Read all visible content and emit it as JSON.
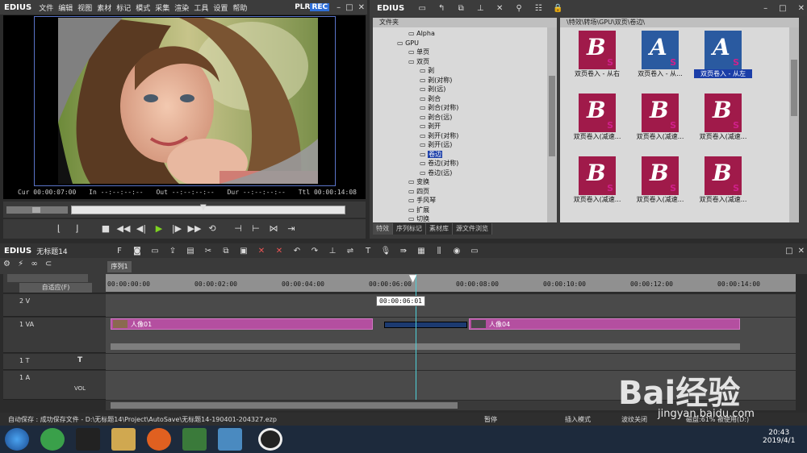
{
  "app": {
    "logo": "EDIUS",
    "menu": [
      "文件",
      "编辑",
      "视图",
      "素材",
      "标记",
      "模式",
      "采集",
      "渲染",
      "工具",
      "设置",
      "帮助"
    ],
    "plr": "PLR",
    "rec": "REC"
  },
  "viewer": {
    "cur_label": "Cur",
    "cur": "00:00:07:00",
    "in_label": "In",
    "in": "--:--:--:--",
    "out_label": "Out",
    "out": "--:--:--:--",
    "dur_label": "Dur",
    "dur": "--:--:--:--",
    "ttl_label": "Ttl",
    "ttl": "00:00:14:08"
  },
  "library": {
    "logo": "EDIUS",
    "folder_header": "文件夹",
    "path": "\\特效\\转场\\GPU\\双页\\卷边\\",
    "tree": [
      {
        "label": "Alpha",
        "level": 2
      },
      {
        "label": "GPU",
        "level": 1
      },
      {
        "label": "单页",
        "level": 2
      },
      {
        "label": "双页",
        "level": 2
      },
      {
        "label": "剥",
        "level": 3
      },
      {
        "label": "剥(对称)",
        "level": 3
      },
      {
        "label": "剥(远)",
        "level": 3
      },
      {
        "label": "剥合",
        "level": 3
      },
      {
        "label": "剥合(对称)",
        "level": 3
      },
      {
        "label": "剥合(远)",
        "level": 3
      },
      {
        "label": "剥开",
        "level": 3
      },
      {
        "label": "剥开(对称)",
        "level": 3
      },
      {
        "label": "剥开(远)",
        "level": 3
      },
      {
        "label": "卷边",
        "level": 3,
        "selected": true
      },
      {
        "label": "卷边(对称)",
        "level": 3
      },
      {
        "label": "卷边(远)",
        "level": 3
      },
      {
        "label": "变换",
        "level": 2
      },
      {
        "label": "四页",
        "level": 2
      },
      {
        "label": "手风琴",
        "level": 2
      },
      {
        "label": "扩展",
        "level": 2
      },
      {
        "label": "切换",
        "level": 2
      }
    ],
    "thumbs": [
      {
        "letter": "B",
        "caption": "双页卷入 - 从右",
        "selected": false
      },
      {
        "letter": "A",
        "caption": "双页卷入 - 从...",
        "selected": false
      },
      {
        "letter": "A",
        "caption": "双页卷入 - 从左",
        "selected": true
      },
      {
        "letter": "B",
        "caption": "双页卷入(减速...",
        "selected": false
      },
      {
        "letter": "B",
        "caption": "双页卷入(减速...",
        "selected": false
      },
      {
        "letter": "B",
        "caption": "双页卷入(减速...",
        "selected": false
      },
      {
        "letter": "B",
        "caption": "双页卷入(减速...",
        "selected": false
      },
      {
        "letter": "B",
        "caption": "双页卷入(减速...",
        "selected": false
      },
      {
        "letter": "B",
        "caption": "双页卷入(减速...",
        "selected": false
      }
    ],
    "tabs": [
      "特效",
      "序列标记",
      "素材库",
      "源文件浏览"
    ]
  },
  "timeline": {
    "logo": "EDIUS",
    "project": "无标题14",
    "sequence_tab": "序列1",
    "fit_label": "自适应(F)",
    "playhead_tc": "00:00:06:01",
    "ruler_labels": [
      "00:00:00:00",
      "00:00:02:00",
      "00:00:04:00",
      "00:00:06:00",
      "00:00:08:00",
      "00:00:10:00",
      "00:00:12:00",
      "00:00:14:00"
    ],
    "tracks": [
      {
        "name": "2 V"
      },
      {
        "name": "1 VA"
      },
      {
        "name": "1 T"
      },
      {
        "name": "1 A"
      }
    ],
    "clips": [
      {
        "label": "人像01"
      },
      {
        "label": "人像04"
      }
    ],
    "vol_label": "VOL"
  },
  "status": {
    "autosave": "自动保存 : 成功保存文件 - D:\\无标题14\\Project\\AutoSave\\无标题14-190401-204327.ezp",
    "pause": "暂停",
    "insert_mode": "插入模式",
    "ripple": "波纹关闭",
    "disk": "磁盘:61% 被使用(D:)"
  },
  "taskbar": {
    "time": "20:43",
    "date": "2019/4/1"
  },
  "watermark": {
    "text": "Bai经验",
    "url": "jingyan.baidu.com"
  }
}
